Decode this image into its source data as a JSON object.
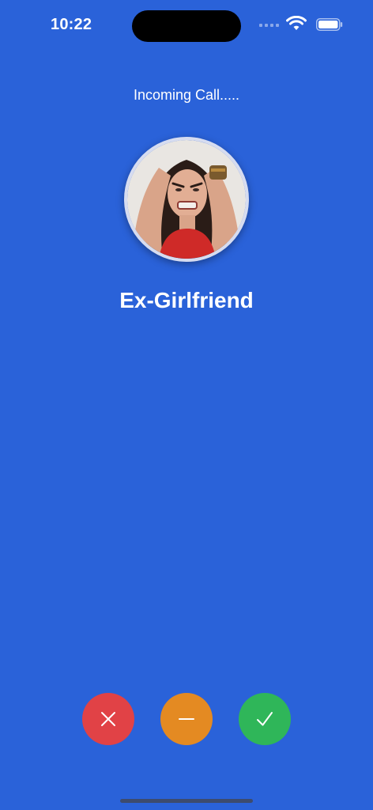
{
  "status_bar": {
    "time": "10:22",
    "icons": [
      "cellular-signal-icon",
      "wifi-icon",
      "battery-icon"
    ]
  },
  "call": {
    "status_text": "Incoming Call.....",
    "contact_name": "Ex-Girlfriend"
  },
  "actions": {
    "decline_icon": "x-icon",
    "message_icon": "minus-icon",
    "accept_icon": "checkmark-icon"
  },
  "colors": {
    "background": "#2a62d9",
    "decline": "#e14246",
    "message": "#e48a22",
    "accept": "#2fb659"
  }
}
